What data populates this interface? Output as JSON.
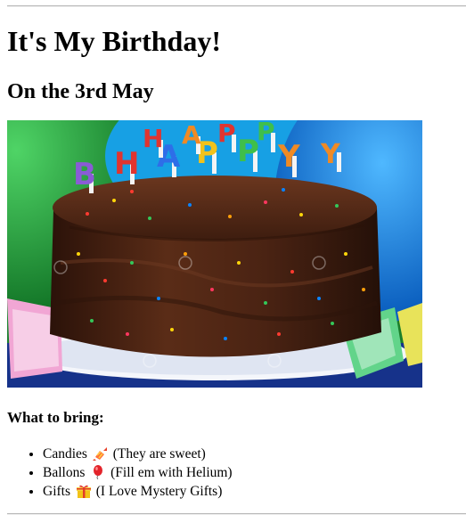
{
  "heading": "It's My Birthday!",
  "subheading": "On the 3rd May",
  "image": {
    "alt": "",
    "candle_letters": [
      "B",
      "H",
      "A",
      "P",
      "P",
      "Y",
      "H",
      "A",
      "P",
      "P",
      "Y"
    ]
  },
  "bring": {
    "title": "What to bring:",
    "items": [
      {
        "name": "Candies",
        "icon": "candy-icon",
        "note": "(They are sweet)"
      },
      {
        "name": "Ballons",
        "icon": "balloon-icon",
        "note": "(Fill em with Helium)"
      },
      {
        "name": "Gifts",
        "icon": "gift-icon",
        "note": "(I Love Mystery Gifts)"
      }
    ]
  },
  "colors": {
    "text": "#000000",
    "rule": "#b8b8b8",
    "cake": "#4a2414",
    "background_balloons": [
      "#1e8f2e",
      "#1b73d6",
      "#2aa3e8"
    ]
  }
}
